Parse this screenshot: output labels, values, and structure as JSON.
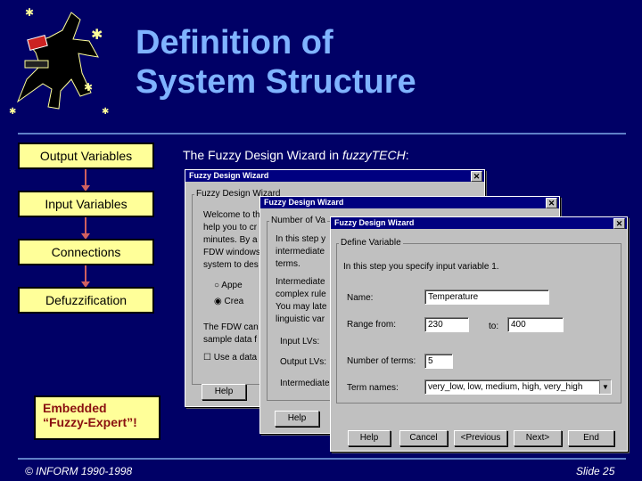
{
  "title": {
    "line1": "Definition of",
    "line2": "System Structure"
  },
  "flow": {
    "steps": [
      "Output Variables",
      "Input Variables",
      "Connections",
      "Defuzzification"
    ],
    "note_line1": "Embedded",
    "note_line2": "“Fuzzy-Expert”!"
  },
  "subheading": {
    "prefix": "The Fuzzy Design Wizard in ",
    "product": "fuzzyTECH",
    "suffix": ":"
  },
  "win1": {
    "title": "Fuzzy Design Wizard",
    "group": "Fuzzy Design Wizard",
    "lines": [
      "Welcome to the",
      "help you to cr",
      "minutes. By a",
      "FDW windows",
      "system to des"
    ],
    "radio1": "Appe",
    "radio2": "Crea",
    "lines2": [
      "The FDW can",
      "sample data f"
    ],
    "checkbox": "Use a data",
    "help": "Help"
  },
  "win2": {
    "title": "Fuzzy Design Wizard",
    "group": "Number of Va",
    "lines": [
      "In this step y",
      "intermediate",
      "terms."
    ],
    "lines2": [
      "Intermediate",
      "complex rule",
      "You may late",
      "linguistic var"
    ],
    "input_lvs": "Input LVs:",
    "output_lvs": "Output LVs:",
    "intermediate": "Intermediate",
    "help": "Help"
  },
  "win3": {
    "title": "Fuzzy Design Wizard",
    "group": "Define Variable",
    "intro": "In this step you specify input variable 1.",
    "name_label": "Name:",
    "name_value": "Temperature",
    "range_label": "Range from:",
    "range_from": "230",
    "to_label": "to:",
    "range_to": "400",
    "terms_label": "Number of terms:",
    "terms_value": "5",
    "term_names_label": "Term names:",
    "term_names_value": "very_low, low, medium, high, very_high",
    "buttons": {
      "help": "Help",
      "cancel": "Cancel",
      "previous": "<Previous",
      "next": "Next>",
      "end": "End"
    }
  },
  "footer": {
    "copyright": "© INFORM 1990-1998",
    "slide": "Slide 25"
  },
  "colors": {
    "background": "#000066",
    "title": "#7fb3ff",
    "box": "#ffff99",
    "connector": "#d06060",
    "titlebar": "#000080"
  }
}
